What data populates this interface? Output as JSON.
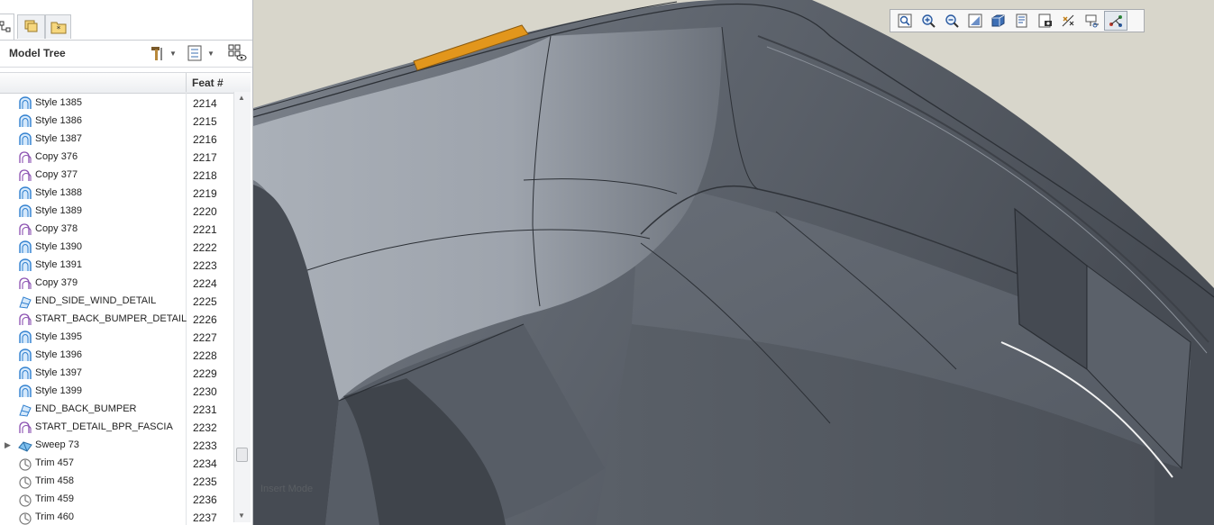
{
  "tabs": [
    {
      "name": "model-tree-tab",
      "icon": "hierarchy-icon",
      "active": true
    },
    {
      "name": "layers-tab",
      "icon": "layers-icon",
      "active": false
    },
    {
      "name": "favorites-tab",
      "icon": "star-folder-icon",
      "active": false
    }
  ],
  "model_tree": {
    "title": "Model Tree",
    "settings_icon": "hammer-icon",
    "show_icon": "list-icon",
    "filter_icon": "tree-filter-icon"
  },
  "columns": {
    "feat": "Feat #"
  },
  "rows": [
    {
      "label": "Style 1385",
      "feat": "2214",
      "icon": "style-icon"
    },
    {
      "label": "Style 1386",
      "feat": "2215",
      "icon": "style-icon"
    },
    {
      "label": "Style 1387",
      "feat": "2216",
      "icon": "style-icon"
    },
    {
      "label": "Copy 376",
      "feat": "2217",
      "icon": "copy-icon"
    },
    {
      "label": "Copy 377",
      "feat": "2218",
      "icon": "copy-icon"
    },
    {
      "label": "Style 1388",
      "feat": "2219",
      "icon": "style-icon"
    },
    {
      "label": "Style 1389",
      "feat": "2220",
      "icon": "style-icon"
    },
    {
      "label": "Copy 378",
      "feat": "2221",
      "icon": "copy-icon"
    },
    {
      "label": "Style 1390",
      "feat": "2222",
      "icon": "style-icon"
    },
    {
      "label": "Style 1391",
      "feat": "2223",
      "icon": "style-icon"
    },
    {
      "label": "Copy 379",
      "feat": "2224",
      "icon": "copy-icon"
    },
    {
      "label": "END_SIDE_WIND_DETAIL",
      "feat": "2225",
      "icon": "end-marker-icon"
    },
    {
      "label": "START_BACK_BUMPER_DETAIL",
      "feat": "2226",
      "icon": "start-marker-icon"
    },
    {
      "label": "Style 1395",
      "feat": "2227",
      "icon": "style-icon"
    },
    {
      "label": "Style 1396",
      "feat": "2228",
      "icon": "style-icon"
    },
    {
      "label": "Style 1397",
      "feat": "2229",
      "icon": "style-icon"
    },
    {
      "label": "Style 1399",
      "feat": "2230",
      "icon": "style-icon"
    },
    {
      "label": "END_BACK_BUMPER",
      "feat": "2231",
      "icon": "end-marker-icon"
    },
    {
      "label": "START_DETAIL_BPR_FASCIA",
      "feat": "2232",
      "icon": "start-marker-icon"
    },
    {
      "label": "Sweep 73",
      "feat": "2233",
      "icon": "sweep-icon",
      "expandable": true
    },
    {
      "label": "Trim 457",
      "feat": "2234",
      "icon": "trim-icon"
    },
    {
      "label": "Trim 458",
      "feat": "2235",
      "icon": "trim-icon"
    },
    {
      "label": "Trim 459",
      "feat": "2236",
      "icon": "trim-icon"
    },
    {
      "label": "Trim 460",
      "feat": "2237",
      "icon": "trim-icon"
    }
  ],
  "view_toolbar": [
    {
      "name": "refit-icon"
    },
    {
      "name": "zoom-in-icon"
    },
    {
      "name": "zoom-out-icon"
    },
    {
      "name": "repaint-icon"
    },
    {
      "name": "display-style-icon"
    },
    {
      "name": "saved-views-icon"
    },
    {
      "name": "view-manager-icon"
    },
    {
      "name": "datum-display-icon"
    },
    {
      "name": "annotation-display-icon"
    },
    {
      "name": "spin-center-icon",
      "pressed": true
    }
  ],
  "status": {
    "mode": "Insert Mode"
  },
  "colors": {
    "surface_light": "#a9aeb6",
    "surface_dark": "#4b5058",
    "background": "#d8d6cb",
    "highlight": "#e2961c",
    "style_icon": "#2f7fcf",
    "copy_icon": "#8a4fb0"
  }
}
